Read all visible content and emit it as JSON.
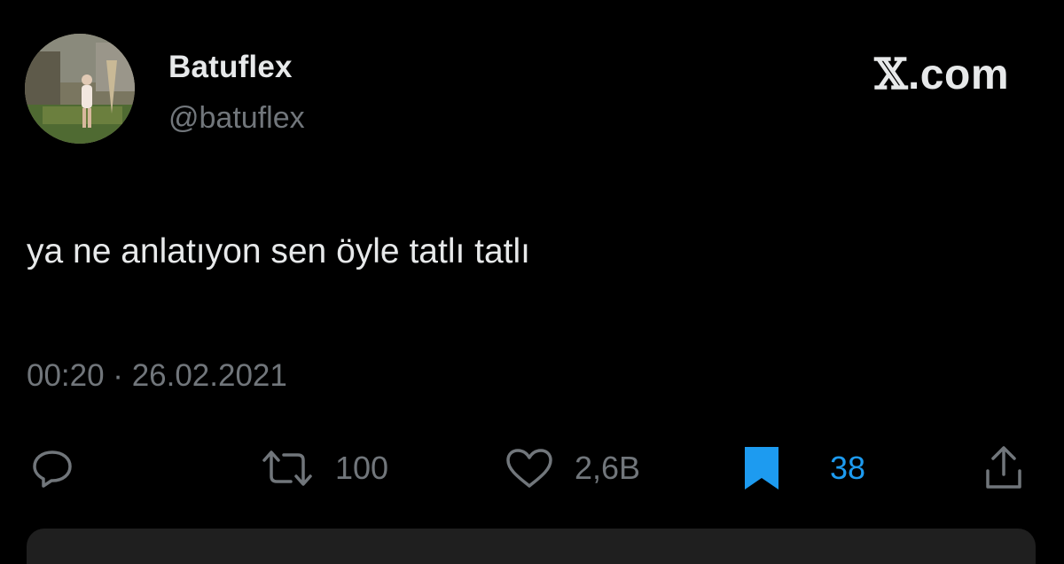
{
  "tweet": {
    "display_name": "Batuflex",
    "handle": "@batuflex",
    "text": "ya ne anlatıyon sen öyle tatlı tatlı",
    "timestamp": "00:20 · 26.02.2021"
  },
  "brand": {
    "x_glyph": "𝕏",
    "domain": ".com"
  },
  "actions": {
    "reply": {
      "icon": "reply-icon"
    },
    "retweet": {
      "icon": "retweet-icon",
      "count": "100"
    },
    "like": {
      "icon": "heart-icon",
      "count": "2,6B"
    },
    "bookmark": {
      "icon": "bookmark-icon",
      "count": "38",
      "color": "#1d9bf0"
    },
    "share": {
      "icon": "share-icon"
    }
  },
  "colors": {
    "background": "#000000",
    "text_primary": "#e7e9ea",
    "text_secondary": "#71767b",
    "accent": "#1d9bf0"
  }
}
